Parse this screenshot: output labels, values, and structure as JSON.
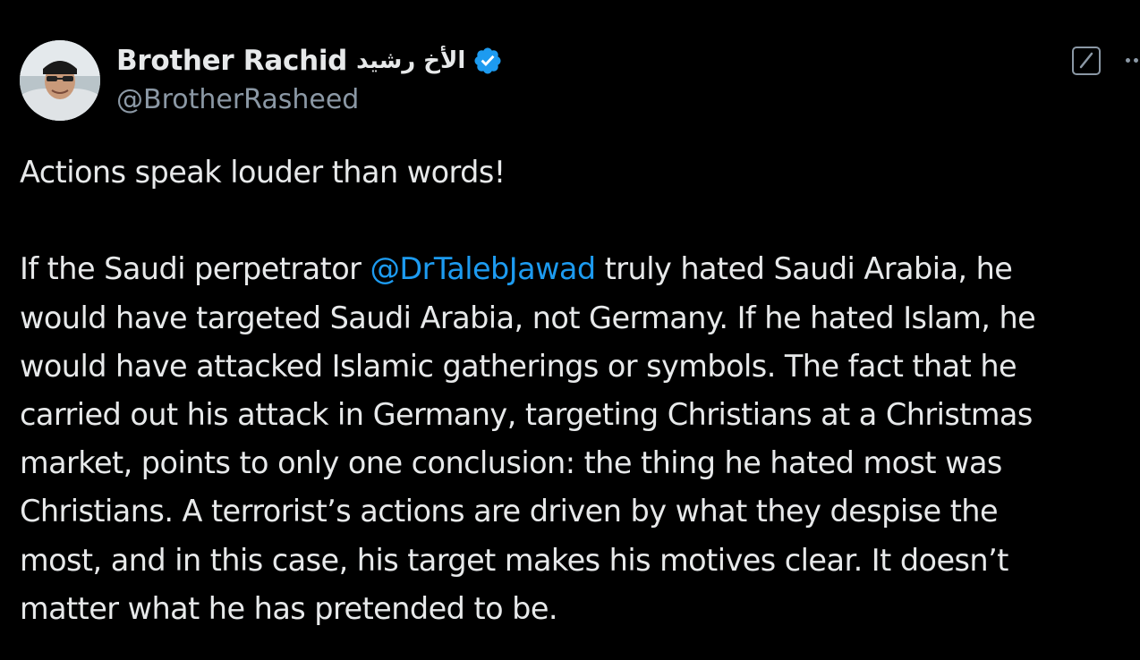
{
  "author": {
    "display_name": "Brother Rachid",
    "display_name_arabic": "الأخ رشيد",
    "handle": "@BrotherRasheed",
    "verified_icon": "verified-badge-icon",
    "verified_color": "#1d9bf0"
  },
  "header_actions": {
    "grok_icon": "grok-icon",
    "more_icon": "more-dots-icon"
  },
  "tweet": {
    "line1": "Actions speak louder than words!",
    "paragraph2": {
      "line1_before": "If the Saudi perpetrator ",
      "mention": "@DrTalebJawad",
      "line1_after": " truly hated Saudi Arabia, he",
      "line2": "would have targeted Saudi Arabia, not Germany. If he hated Islam, he",
      "line3": "would have attacked Islamic gatherings or symbols. The fact that he",
      "line4": "carried out his attack in Germany, targeting Christians at a Christmas",
      "line5": "market, points to only one conclusion: the thing he hated most was",
      "line6": "Christians. A terrorist’s actions are driven by what they despise the",
      "line7": "most, and in this case, his target makes his motives clear. It doesn’t",
      "line8": "matter what he has pretended to be."
    }
  },
  "colors": {
    "background": "#000000",
    "text": "#e7e9ea",
    "secondary": "#8b98a5",
    "link": "#1d9bf0"
  }
}
